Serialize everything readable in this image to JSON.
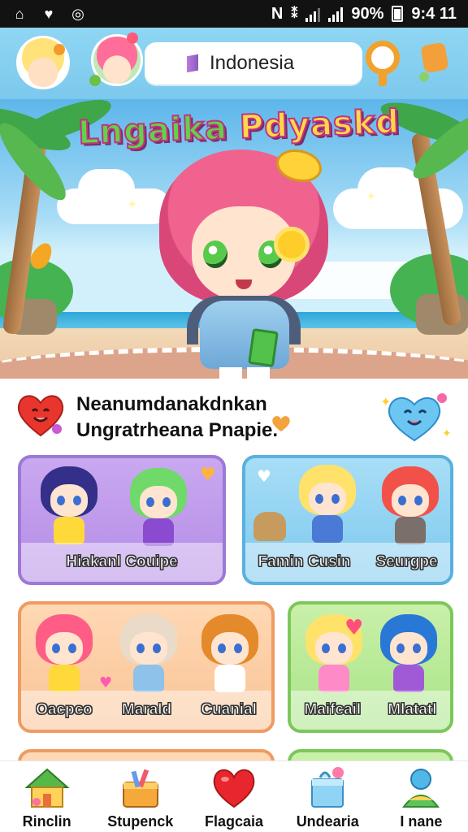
{
  "status_bar": {
    "battery": "90%",
    "time": "9:4 11",
    "net_label": "N",
    "icons": [
      "home-icon",
      "heart-icon",
      "gamepad-icon",
      "nfc-icon",
      "vibrate-icon",
      "signal-icon",
      "signal-icon",
      "battery-icon"
    ]
  },
  "header": {
    "search_value": "Indonesia",
    "icons": [
      "avatar-profile",
      "avatar-friend",
      "flag-icon",
      "key-icon",
      "bag-icon"
    ]
  },
  "banner": {
    "title_part1": "Lngaika",
    "title_part2": "Pdyaskd"
  },
  "welcome": {
    "line1": "Neanumdanakdnkan",
    "line2": "Ungratrheana Pnapie."
  },
  "cards": [
    {
      "labels": [
        "Hiakanl Couipe"
      ]
    },
    {
      "labels": [
        "Famin Cusin",
        "Seurgpe"
      ]
    },
    {
      "labels": [
        "Oacpco",
        "Marald",
        "Cuanial"
      ]
    },
    {
      "labels": [
        "Maifcail",
        "Mlatatl"
      ]
    }
  ],
  "nav": [
    {
      "label": "Rinclin",
      "icon": "house-icon"
    },
    {
      "label": "Stupenck",
      "icon": "basket-icon"
    },
    {
      "label": "Flagcaia",
      "icon": "heart-icon"
    },
    {
      "label": "Undearia",
      "icon": "gift-box-icon"
    },
    {
      "label": "I nane",
      "icon": "profile-icon"
    }
  ],
  "colors": {
    "header_bg": "#8fd6f2",
    "card_purple": "#caa8f0",
    "card_blue": "#a8def6",
    "card_orange": "#ffd8b4",
    "card_green": "#c9f0a9",
    "accent_heart": "#e8262e"
  }
}
